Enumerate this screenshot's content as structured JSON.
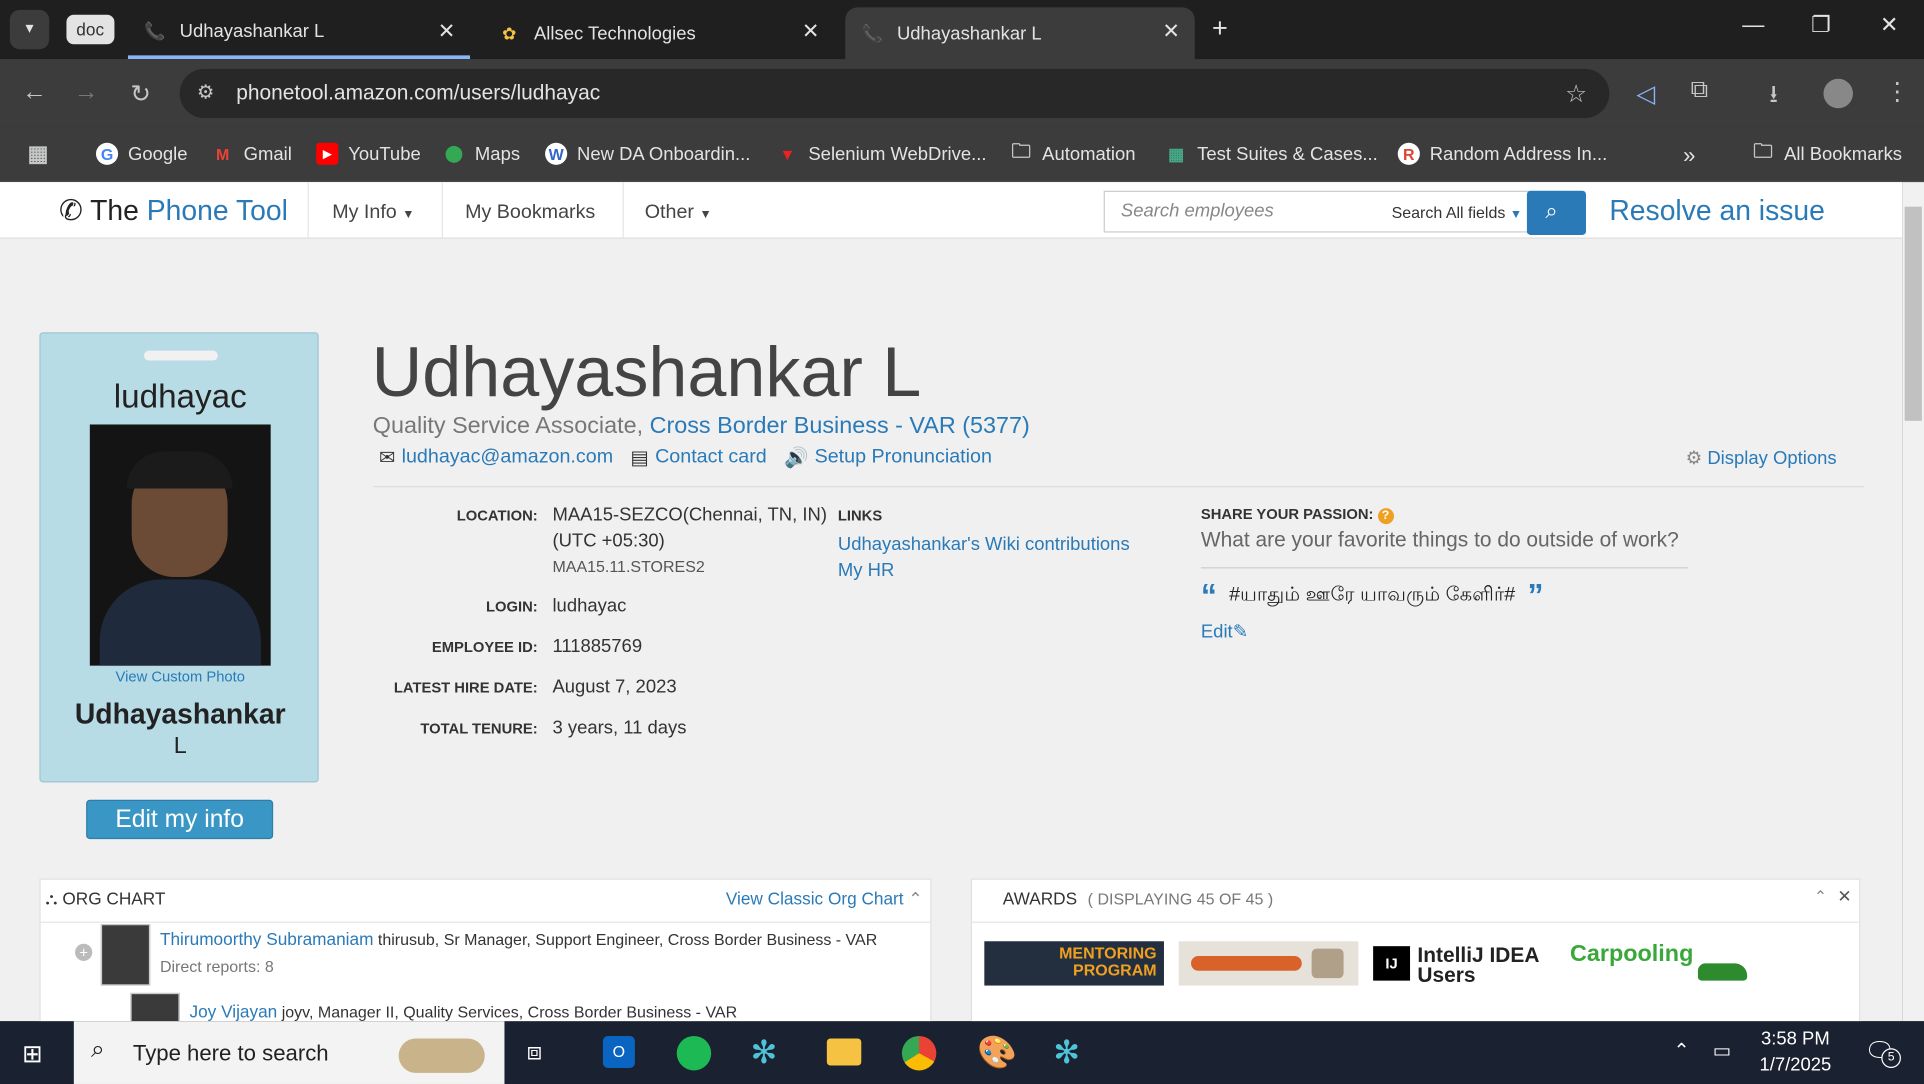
{
  "browser": {
    "tabs": [
      {
        "label": "Udhayashankar L",
        "active": false
      },
      {
        "label": "Allsec Technologies",
        "active": false
      },
      {
        "label": "Udhayashankar L",
        "active": true
      }
    ],
    "group_label": "doc",
    "url": "phonetool.amazon.com/users/ludhayac",
    "bookmarks": [
      "Google",
      "Gmail",
      "YouTube",
      "Maps",
      "New DA Onboardin...",
      "Selenium WebDrive...",
      "Automation",
      "Test Suites & Cases...",
      "Random Address In..."
    ],
    "all_bookmarks": "All Bookmarks"
  },
  "nav": {
    "brand_the": "The",
    "brand_name": "Phone Tool",
    "my_info": "My Info",
    "my_bookmarks": "My Bookmarks",
    "other": "Other",
    "search_placeholder": "Search employees",
    "search_scope": "Search All fields",
    "resolve": "Resolve an issue"
  },
  "badge": {
    "login": "ludhayac",
    "view_custom_photo": "View Custom Photo",
    "first": "Udhayashankar",
    "last": "L",
    "edit": "Edit my info"
  },
  "profile": {
    "name": "Udhayashankar L",
    "title": "Quality Service Associate,",
    "org": "Cross Border Business - VAR (5377)",
    "email": "ludhayac@amazon.com",
    "contact_card": "Contact card",
    "pronunciation": "Setup Pronunciation",
    "display_options": "Display Options",
    "fields": [
      {
        "label": "LOCATION:",
        "value": "MAA15-SEZCO(Chennai, TN, IN)"
      },
      {
        "label": "LOGIN:",
        "value": "ludhayac"
      },
      {
        "label": "EMPLOYEE ID:",
        "value": "111885769"
      },
      {
        "label": "LATEST HIRE DATE:",
        "value": "August 7, 2023"
      },
      {
        "label": "TOTAL TENURE:",
        "value": "3 years, 11 days"
      }
    ],
    "location_tz": "(UTC +05:30)",
    "location_sub": "MAA15.11.STORES2",
    "links_title": "LINKS",
    "links": [
      "Udhayashankar's Wiki contributions",
      "My HR"
    ],
    "passion_title": "SHARE YOUR PASSION:",
    "passion_q": "What are your favorite things to do outside of work?",
    "passion_a": "#யாதும் ஊரே யாவரும் கேளிர்#",
    "edit": "Edit"
  },
  "org_chart": {
    "title": "ORG CHART",
    "classic": "View Classic Org Chart",
    "people": [
      {
        "name": "Thirumoorthy Subramaniam",
        "detail": "thirusub, Sr Manager, Support Engineer, Cross Border Business - VAR",
        "reports": "Direct reports: 8"
      },
      {
        "name": "Joy Vijayan",
        "detail": "joyv, Manager II, Quality Services, Cross Border Business - VAR"
      }
    ]
  },
  "awards": {
    "title": "AWARDS",
    "count": "( DISPLAYING 45 OF 45 )",
    "items": [
      "MENTORING PROGRAM",
      "IntelliJ IDEA Users",
      "Carpooling"
    ]
  },
  "taskbar": {
    "search": "Type here to search",
    "time": "3:58 PM",
    "date": "1/7/2025",
    "notif": "5"
  },
  "colors": {
    "accent": "#2a7ab8",
    "badge_bg": "#b8dce6",
    "browser_dark": "#3c3c3c"
  }
}
